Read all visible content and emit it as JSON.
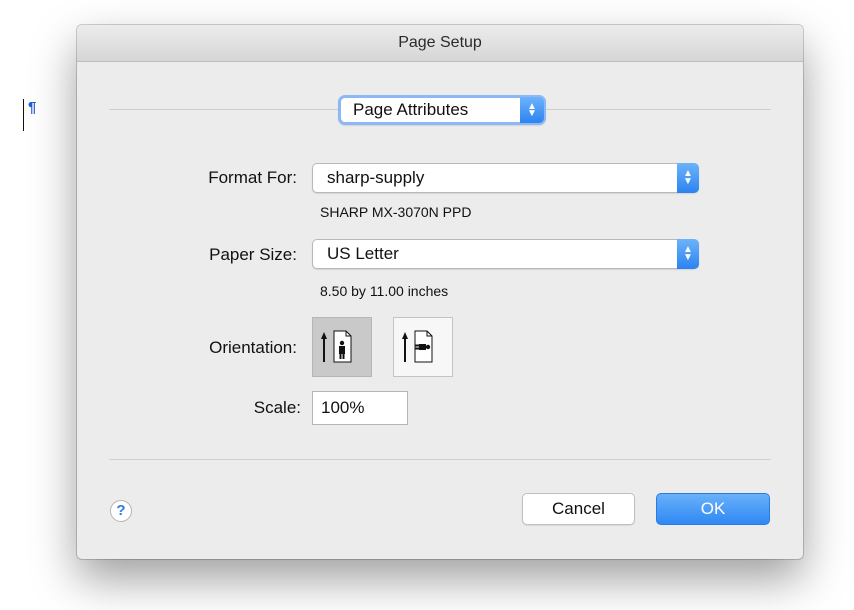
{
  "document": {
    "pilcrow": "¶"
  },
  "dialog": {
    "title": "Page Setup",
    "settings_popup": {
      "value": "Page Attributes",
      "icon": "chevron-up-down-icon"
    },
    "format_for": {
      "label": "Format For:",
      "value": "sharp-supply",
      "detail": "SHARP MX-3070N PPD"
    },
    "paper_size": {
      "label": "Paper Size:",
      "value": "US Letter",
      "detail": "8.50 by 11.00 inches"
    },
    "orientation": {
      "label": "Orientation:",
      "options": [
        "portrait",
        "landscape"
      ],
      "selected": "portrait"
    },
    "scale": {
      "label": "Scale:",
      "value": "100%"
    },
    "help_label": "?",
    "cancel_label": "Cancel",
    "ok_label": "OK"
  },
  "colors": {
    "accent": "#2f88f3",
    "dialog_bg": "#ececec",
    "pilcrow": "#1e5ed6"
  }
}
